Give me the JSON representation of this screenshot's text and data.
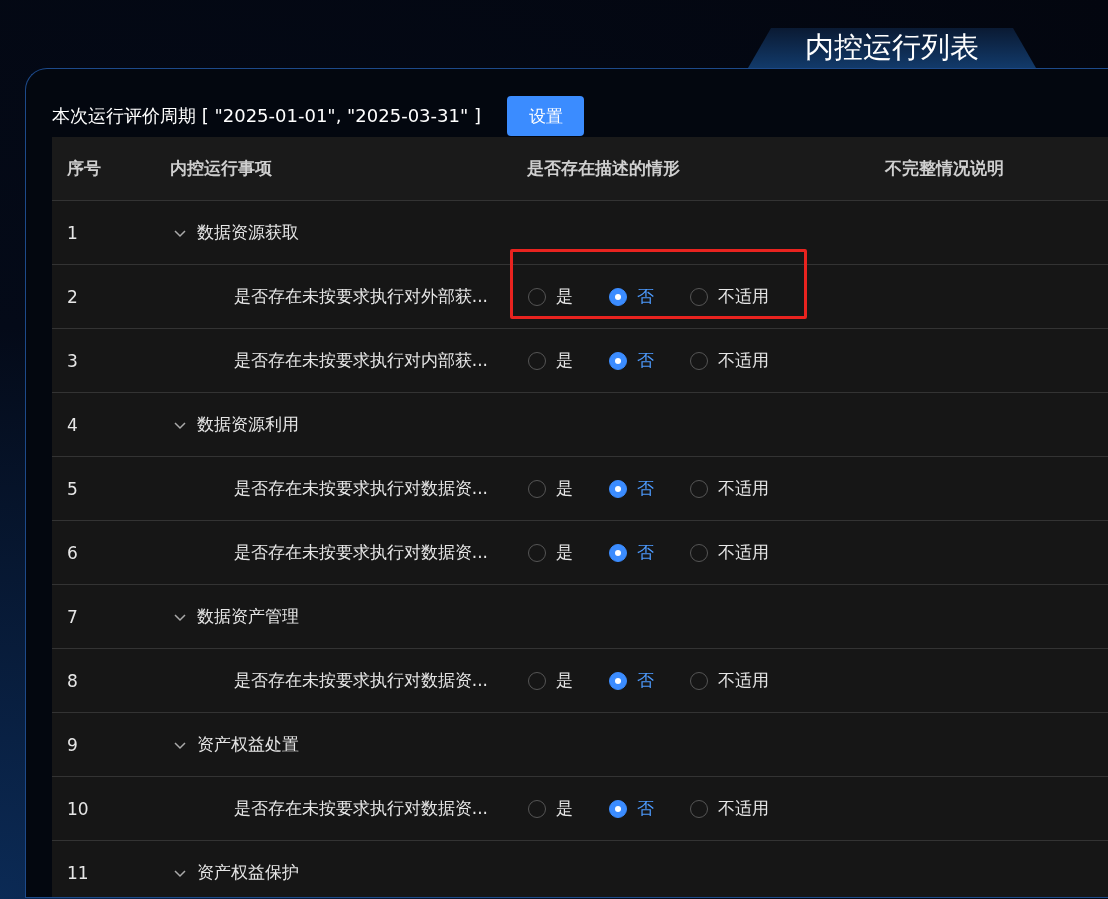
{
  "title": "内控运行列表",
  "period": {
    "label": "本次运行评价周期 [ \"2025-01-01\", \"2025-03-31\" ]",
    "button": "设置"
  },
  "table": {
    "columns": [
      "序号",
      "内控运行事项",
      "是否存在描述的情形",
      "不完整情况说明"
    ],
    "rows": [
      {
        "kind": "group",
        "index": "1",
        "text": "数据资源获取",
        "expanded": true
      },
      {
        "kind": "item",
        "index": "2",
        "text": "是否存在未按要求执行对外部获...",
        "highlighted": true,
        "options": [
          {
            "label": "是",
            "selected": false
          },
          {
            "label": "否",
            "selected": true
          },
          {
            "label": "不适用",
            "selected": false
          }
        ]
      },
      {
        "kind": "item",
        "index": "3",
        "text": "是否存在未按要求执行对内部获...",
        "highlighted": false,
        "options": [
          {
            "label": "是",
            "selected": false
          },
          {
            "label": "否",
            "selected": true
          },
          {
            "label": "不适用",
            "selected": false
          }
        ]
      },
      {
        "kind": "group",
        "index": "4",
        "text": "数据资源利用",
        "expanded": true
      },
      {
        "kind": "item",
        "index": "5",
        "text": "是否存在未按要求执行对数据资...",
        "highlighted": false,
        "options": [
          {
            "label": "是",
            "selected": false
          },
          {
            "label": "否",
            "selected": true
          },
          {
            "label": "不适用",
            "selected": false
          }
        ]
      },
      {
        "kind": "item",
        "index": "6",
        "text": "是否存在未按要求执行对数据资...",
        "highlighted": false,
        "options": [
          {
            "label": "是",
            "selected": false
          },
          {
            "label": "否",
            "selected": true
          },
          {
            "label": "不适用",
            "selected": false
          }
        ]
      },
      {
        "kind": "group",
        "index": "7",
        "text": "数据资产管理",
        "expanded": true
      },
      {
        "kind": "item",
        "index": "8",
        "text": "是否存在未按要求执行对数据资...",
        "highlighted": false,
        "options": [
          {
            "label": "是",
            "selected": false
          },
          {
            "label": "否",
            "selected": true
          },
          {
            "label": "不适用",
            "selected": false
          }
        ]
      },
      {
        "kind": "group",
        "index": "9",
        "text": "资产权益处置",
        "expanded": true
      },
      {
        "kind": "item",
        "index": "10",
        "text": "是否存在未按要求执行对数据资...",
        "highlighted": false,
        "options": [
          {
            "label": "是",
            "selected": false
          },
          {
            "label": "否",
            "selected": true
          },
          {
            "label": "不适用",
            "selected": false
          }
        ]
      },
      {
        "kind": "group",
        "index": "11",
        "text": "资产权益保护",
        "expanded": true
      }
    ]
  }
}
